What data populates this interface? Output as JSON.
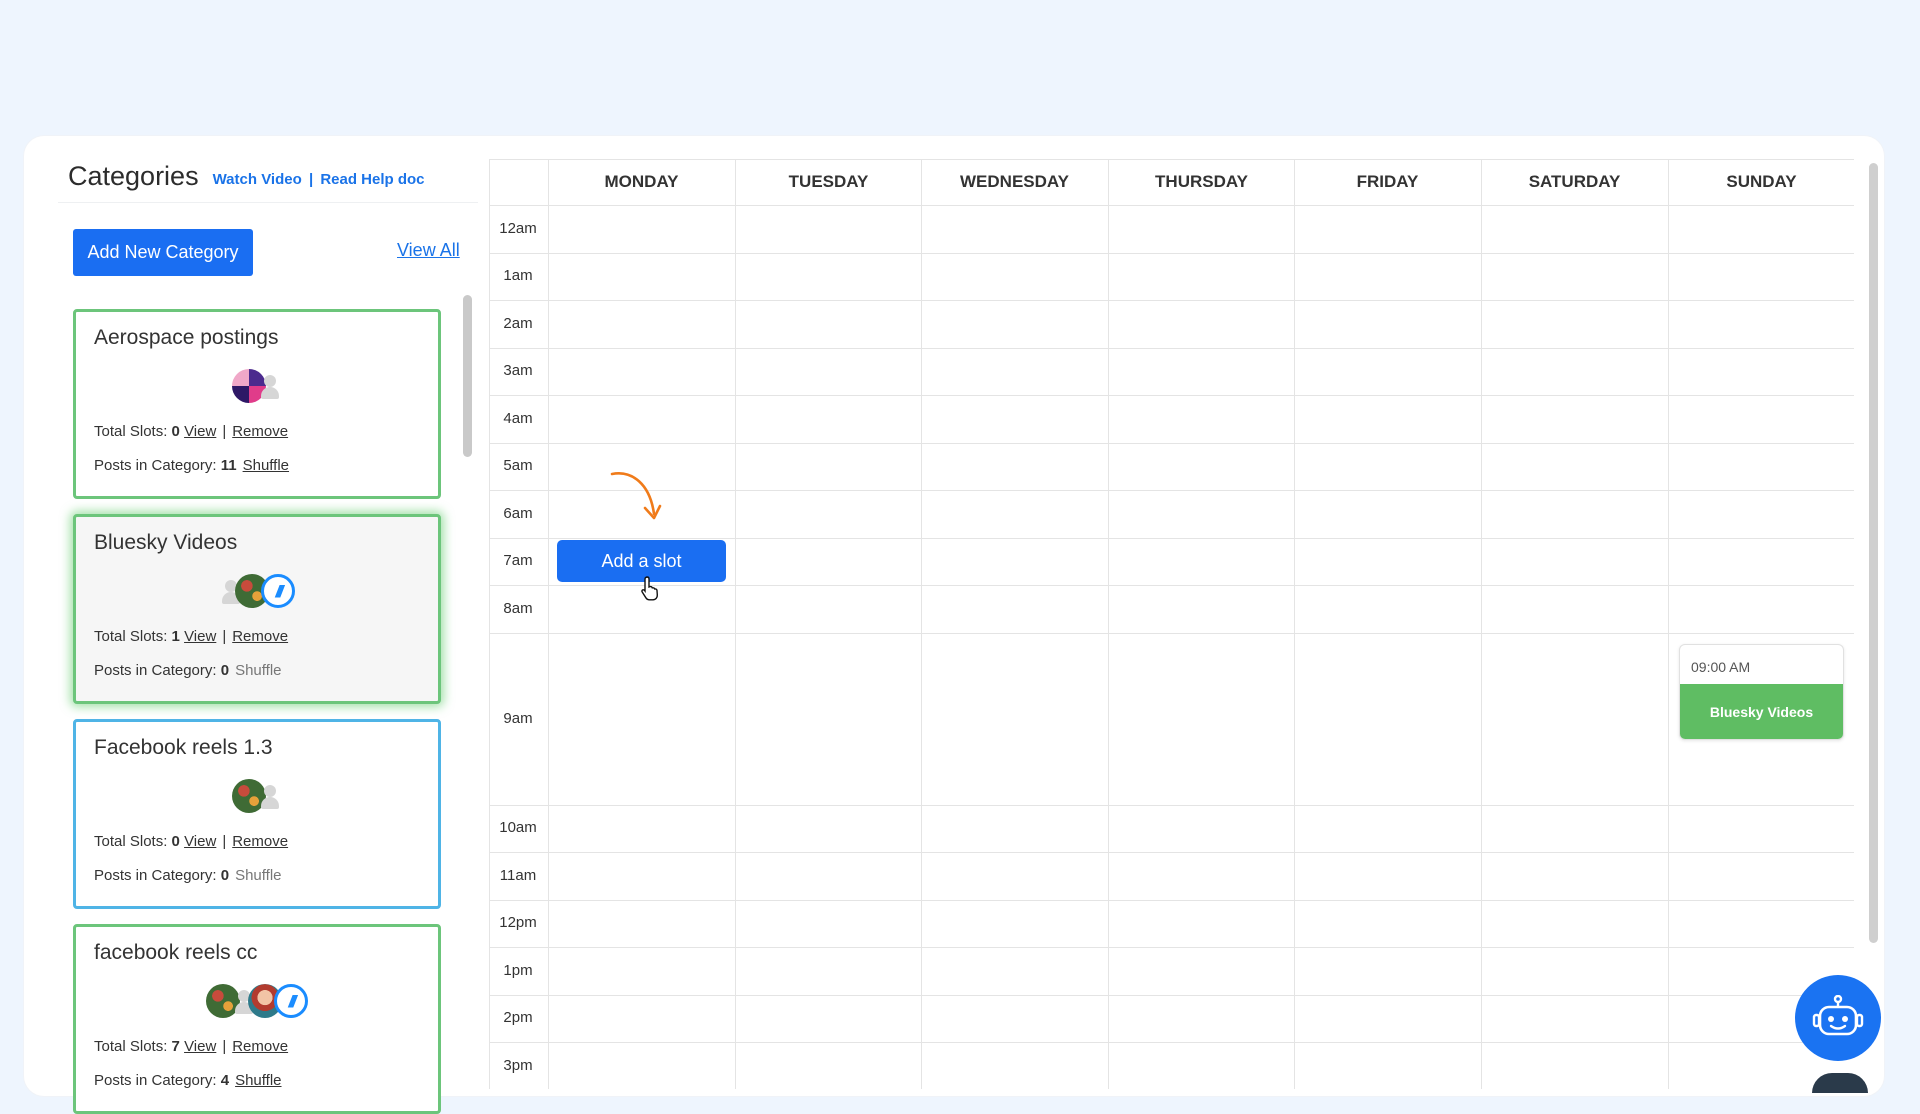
{
  "categories_panel": {
    "title": "Categories",
    "watch_video": "Watch Video",
    "separator": "|",
    "read_help": "Read Help doc",
    "add_button": "Add New Category",
    "view_all": "View All"
  },
  "card_labels": {
    "total_slots": "Total Slots:",
    "posts_in_category": "Posts in Category:",
    "view": "View",
    "remove": "Remove",
    "pipe": "|",
    "shuffle": "Shuffle"
  },
  "categories": [
    {
      "name": "Aerospace postings",
      "total_slots": "0",
      "posts": "11",
      "border": "green",
      "avatars": [
        "purple-avatar",
        "placeholder-avatar"
      ]
    },
    {
      "name": "Bluesky Videos",
      "total_slots": "1",
      "posts": "0",
      "border": "green",
      "selected": true,
      "avatars": [
        "placeholder-avatar",
        "green-avatar",
        "bluesky-avatar"
      ]
    },
    {
      "name": "Facebook reels 1.3",
      "total_slots": "0",
      "posts": "0",
      "border": "blue",
      "avatars": [
        "green-avatar",
        "placeholder-avatar"
      ]
    },
    {
      "name": "facebook reels cc",
      "total_slots": "7",
      "posts": "4",
      "border": "green",
      "avatars": [
        "green-avatar",
        "placeholder-avatar",
        "face-avatar",
        "bluesky-avatar"
      ]
    }
  ],
  "calendar": {
    "days": [
      "MONDAY",
      "TUESDAY",
      "WEDNESDAY",
      "THURSDAY",
      "FRIDAY",
      "SATURDAY",
      "SUNDAY"
    ],
    "times": [
      "12am",
      "1am",
      "2am",
      "3am",
      "4am",
      "5am",
      "6am",
      "7am",
      "8am",
      "9am",
      "10am",
      "11am",
      "12pm",
      "1pm",
      "2pm",
      "3pm"
    ],
    "add_slot_label": "Add a slot",
    "event": {
      "time": "09:00 AM",
      "label": "Bluesky Videos",
      "day": "SUNDAY"
    }
  },
  "colors": {
    "primary": "#1a6ef2",
    "card_green": "#6cc57b",
    "card_blue": "#4fb4e6",
    "event_green": "#5fbd63",
    "arrow": "#f07b1a"
  },
  "icons": {
    "assistant": "robot-icon",
    "annotation": "curved-arrow-icon",
    "pointer": "hand-cursor-icon"
  }
}
